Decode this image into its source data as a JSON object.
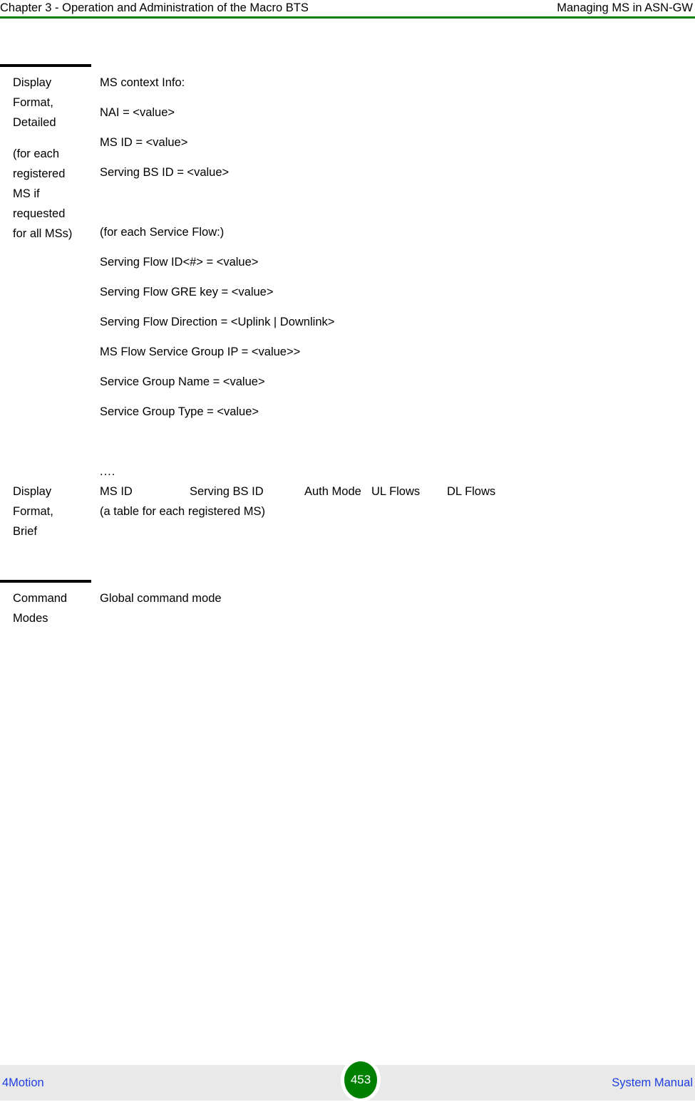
{
  "header": {
    "left": "Chapter 3 - Operation and Administration of the Macro BTS",
    "right": "Managing MS in ASN-GW",
    "rule_color": "#008000"
  },
  "table": {
    "rows": [
      {
        "label_lines": [
          "Display",
          "Format,",
          "Detailed"
        ],
        "label_note_lines": [
          "(for each",
          "registered",
          "MS if",
          "requested",
          "for all MSs)"
        ],
        "body_lines": [
          "MS context Info:",
          "NAI = <value>",
          "MS ID = <value>",
          "Serving BS ID = <value>",
          "(for each Service Flow:)",
          "Serving Flow ID<#> = <value>",
          "Serving Flow GRE key = <value>",
          "Serving Flow Direction = <Uplink | Downlink>",
          "MS Flow Service Group IP = <value>>",
          "Service Group Name = <value>",
          "Service Group Type = <value>"
        ],
        "trailing_dots": "...."
      },
      {
        "label_lines": [
          "Display",
          "Format,",
          "Brief"
        ],
        "columns": [
          "MS ID",
          "Serving BS ID",
          "Auth Mode",
          "UL Flows",
          "DL Flows"
        ],
        "body_lines": [
          "(a table for each registered MS)"
        ]
      },
      {
        "label_lines": [
          "Command",
          "Modes"
        ],
        "body_lines": [
          "Global command mode"
        ]
      }
    ]
  },
  "footer": {
    "left": "4Motion",
    "page_number": "453",
    "right": "System Manual",
    "badge_color": "#008000",
    "link_color": "#1f3fe0",
    "band_color": "#e9e9e9"
  }
}
